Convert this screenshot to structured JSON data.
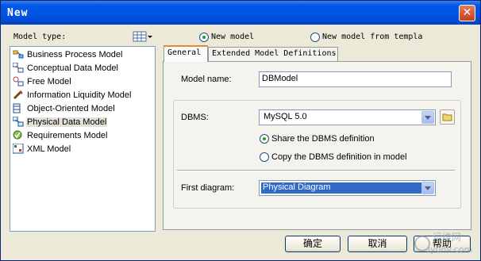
{
  "window": {
    "title": "New",
    "close_symbol": "✕"
  },
  "model_type": {
    "label": "Model type:",
    "items": [
      {
        "label": "Business Process Model",
        "icon": "business-process-icon"
      },
      {
        "label": "Conceptual Data Model",
        "icon": "conceptual-data-icon"
      },
      {
        "label": "Free Model",
        "icon": "free-model-icon"
      },
      {
        "label": "Information Liquidity Model",
        "icon": "information-liquidity-icon"
      },
      {
        "label": "Object-Oriented Model",
        "icon": "object-oriented-icon"
      },
      {
        "label": "Physical Data Model",
        "icon": "physical-data-icon",
        "selected": true
      },
      {
        "label": "Requirements Model",
        "icon": "requirements-icon"
      },
      {
        "label": "XML Model",
        "icon": "xml-model-icon"
      }
    ]
  },
  "options": {
    "new_model": "New model",
    "from_template": "New model from templa",
    "selected": "new_model"
  },
  "tabs": [
    {
      "label": "General",
      "active": true
    },
    {
      "label": "Extended Model Definitions",
      "active": false
    }
  ],
  "general": {
    "model_name_label": "Model name:",
    "model_name_value": "DBModel",
    "dbms_label": "DBMS:",
    "dbms_value": "MySQL 5.0",
    "share_label": "Share the DBMS definition",
    "copy_label": "Copy the DBMS definition in model",
    "dbms_mode": "share",
    "first_diagram_label": "First diagram:",
    "first_diagram_value": "Physical Diagram"
  },
  "buttons": {
    "ok": "确定",
    "cancel": "取消",
    "help": "帮助"
  },
  "watermark": {
    "line1": "运维网",
    "line2": "iyunv.com"
  }
}
